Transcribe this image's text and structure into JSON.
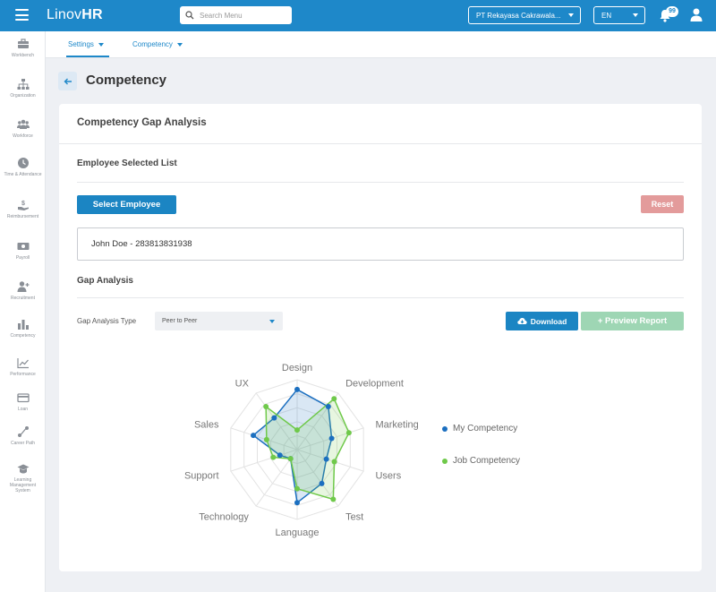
{
  "app": {
    "logo_light": "Linov",
    "logo_bold": "HR",
    "search_placeholder": "Search Menu",
    "company": "PT Rekayasa Cakrawala...",
    "language": "EN",
    "notification_count": "99"
  },
  "sidebar": {
    "items": [
      {
        "label": "Workbench",
        "icon": "briefcase-icon"
      },
      {
        "label": "Organization",
        "icon": "org-chart-icon"
      },
      {
        "label": "Workforce",
        "icon": "users-icon"
      },
      {
        "label": "Time & Attendance",
        "icon": "clock-icon"
      },
      {
        "label": "Reimbursement",
        "icon": "reimbursement-icon"
      },
      {
        "label": "Payroll",
        "icon": "money-icon"
      },
      {
        "label": "Recruitment",
        "icon": "user-plus-icon"
      },
      {
        "label": "Competency",
        "icon": "bar-chart-icon"
      },
      {
        "label": "Performance",
        "icon": "line-chart-icon"
      },
      {
        "label": "Loan",
        "icon": "credit-card-icon"
      },
      {
        "label": "Career Path",
        "icon": "career-path-icon"
      },
      {
        "label": "Learning Management System",
        "icon": "graduation-cap-icon"
      }
    ]
  },
  "subnav": {
    "tabs": [
      {
        "label": "Settings",
        "active": true
      },
      {
        "label": "Competency",
        "active": false
      }
    ]
  },
  "page": {
    "title": "Competency"
  },
  "card": {
    "title": "Competency Gap Analysis",
    "employee_section_title": "Employee Selected List",
    "select_employee_label": "Select Employee",
    "reset_label": "Reset",
    "selected_employee": "John Doe - 283813831938",
    "gap_section_title": "Gap Analysis",
    "gap_type_label": "Gap Analysis Type",
    "gap_type_value": "Peer to Peer",
    "download_label": "Download",
    "preview_label": "+ Preview Report"
  },
  "colors": {
    "primary": "#1e88c9",
    "reset": "#e39b9b",
    "preview": "#9ed6b4",
    "my_competency": "#1b6fc0",
    "job_competency": "#6fc94a"
  },
  "chart_data": {
    "type": "radar",
    "axes": [
      "Design",
      "Development",
      "Marketing",
      "Users",
      "Test",
      "Language",
      "Technology",
      "Support",
      "Sales",
      "UX"
    ],
    "range": [
      0,
      5
    ],
    "series": [
      {
        "name": "My Competency",
        "values": [
          4.3,
          3.8,
          2.6,
          2.2,
          3.0,
          3.8,
          0.8,
          1.3,
          3.3,
          2.8
        ]
      },
      {
        "name": "Job Competency",
        "values": [
          1.4,
          4.5,
          3.9,
          2.8,
          4.4,
          2.8,
          0.8,
          1.8,
          2.3,
          3.8
        ]
      }
    ],
    "legend_position": "right"
  }
}
